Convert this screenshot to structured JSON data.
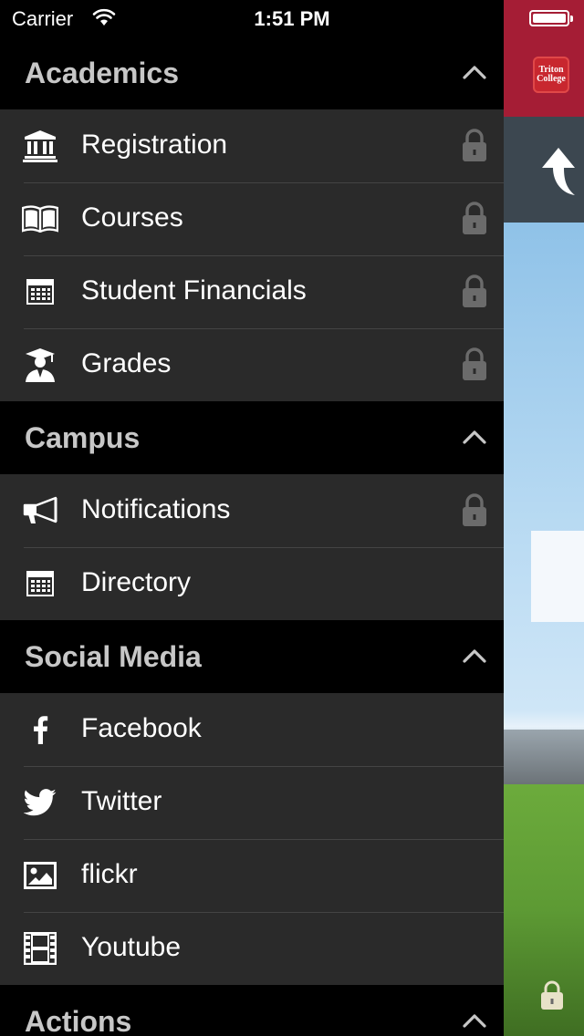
{
  "status_bar": {
    "carrier": "Carrier",
    "time": "1:51 PM",
    "battery_level": 1.0
  },
  "background_app": {
    "logo_line1": "Triton",
    "logo_line2": "College",
    "brand_color": "#a51d35"
  },
  "sections": [
    {
      "title": "Academics",
      "expanded": true,
      "items": [
        {
          "label": "Registration",
          "icon": "bank-icon",
          "locked": true
        },
        {
          "label": "Courses",
          "icon": "book-icon",
          "locked": true
        },
        {
          "label": "Student Financials",
          "icon": "calculator-icon",
          "locked": true
        },
        {
          "label": "Grades",
          "icon": "graduate-icon",
          "locked": true
        }
      ]
    },
    {
      "title": "Campus",
      "expanded": true,
      "items": [
        {
          "label": "Notifications",
          "icon": "megaphone-icon",
          "locked": true
        },
        {
          "label": "Directory",
          "icon": "calculator-icon",
          "locked": false
        }
      ]
    },
    {
      "title": "Social Media",
      "expanded": true,
      "items": [
        {
          "label": "Facebook",
          "icon": "facebook-icon",
          "locked": false
        },
        {
          "label": "Twitter",
          "icon": "twitter-icon",
          "locked": false
        },
        {
          "label": "flickr",
          "icon": "image-icon",
          "locked": false
        },
        {
          "label": "Youtube",
          "icon": "film-icon",
          "locked": false
        }
      ]
    },
    {
      "title": "Actions",
      "expanded": true,
      "items": []
    }
  ]
}
